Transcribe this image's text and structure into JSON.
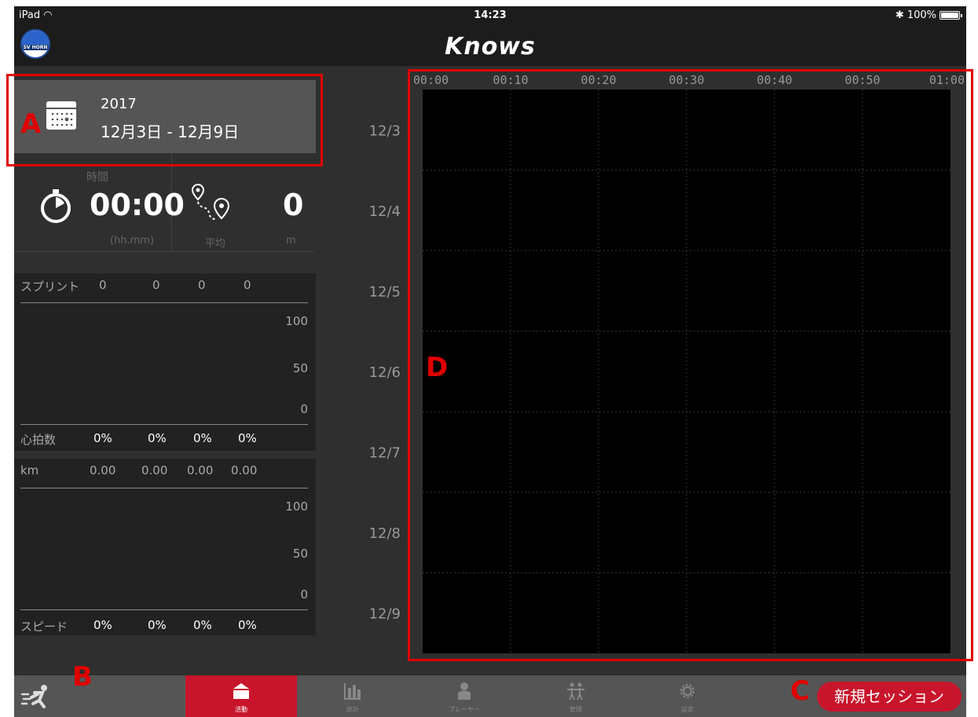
{
  "status_bar": {
    "device": "iPad",
    "time": "14:23",
    "battery": "100%"
  },
  "app": {
    "title": "Knows",
    "logo_text": "SV HORN"
  },
  "date_card": {
    "year": "2017",
    "range": "12月3日 - 12月9日"
  },
  "summary": {
    "time_label": "時間",
    "time_value": "00:00",
    "time_unit": "(hh.mm)",
    "distance_value": "0",
    "avg_label": "平均",
    "distance_unit": "m"
  },
  "sprint_panel": {
    "label": "スプリント",
    "values": [
      "0",
      "0",
      "0",
      "0"
    ],
    "scale": [
      "100",
      "50",
      "0"
    ],
    "heart_label": "心拍数",
    "heart_values": [
      "0%",
      "0%",
      "0%",
      "0%"
    ]
  },
  "distance_panel": {
    "label": "km",
    "values": [
      "0.00",
      "0.00",
      "0.00",
      "0.00"
    ],
    "scale": [
      "100",
      "50",
      "0"
    ],
    "speed_label": "スピード",
    "speed_values": [
      "0%",
      "0%",
      "0%",
      "0%"
    ]
  },
  "chart_data": {
    "type": "heatmap",
    "x_ticks": [
      "00:00",
      "00:10",
      "00:20",
      "00:30",
      "00:40",
      "00:50",
      "01:00"
    ],
    "y_categories": [
      "12/3",
      "12/4",
      "12/5",
      "12/6",
      "12/7",
      "12/8",
      "12/9"
    ],
    "xlim": [
      "00:00",
      "01:00"
    ],
    "grid": true,
    "values": []
  },
  "tab_bar": {
    "tabs": [
      {
        "label": "活動",
        "icon": "house-icon"
      },
      {
        "label": "統計",
        "icon": "bar-chart-icon"
      },
      {
        "label": "プレーヤー",
        "icon": "player-icon"
      },
      {
        "label": "管理",
        "icon": "team-icon"
      },
      {
        "label": "設定",
        "icon": "gear-icon"
      }
    ],
    "new_session": "新規セッション"
  },
  "annotations": {
    "a": "A",
    "b": "B",
    "c": "C",
    "d": "D"
  },
  "colors": {
    "accent": "#c8152b",
    "annotation": "#e00000",
    "background": "#2f2f2f"
  }
}
